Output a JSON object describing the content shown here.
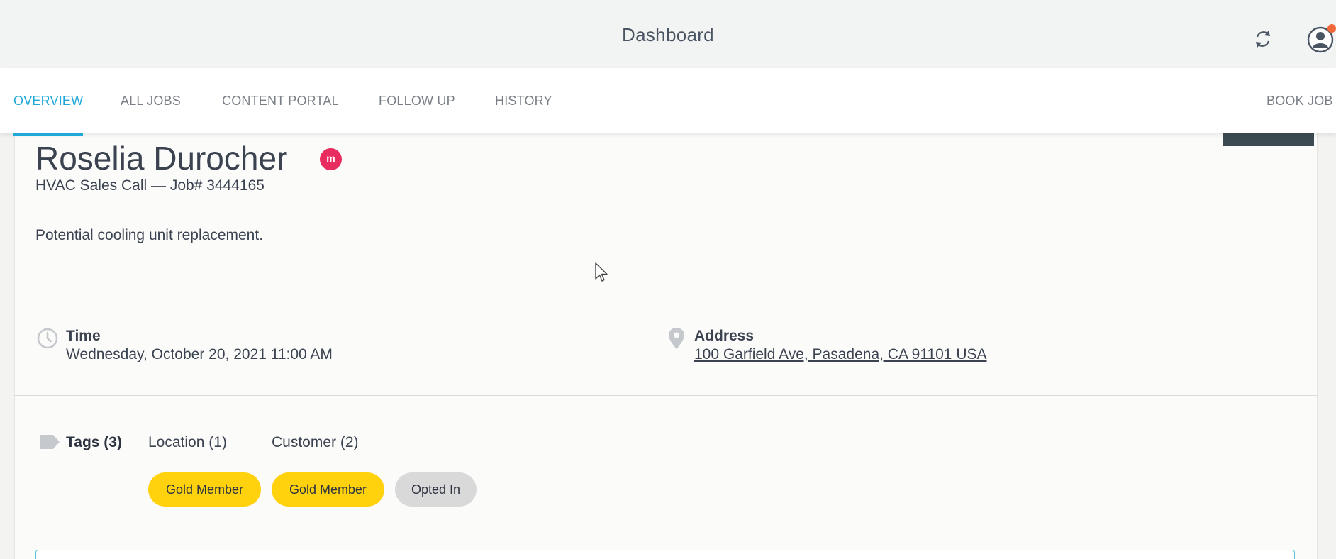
{
  "header": {
    "title": "Dashboard",
    "sync_icon": "sync-icon",
    "avatar_icon": "user-avatar-icon",
    "notification_color": "#f2683a"
  },
  "nav": {
    "tabs": [
      {
        "label": "OVERVIEW",
        "active": true
      },
      {
        "label": "ALL JOBS",
        "active": false
      },
      {
        "label": "CONTENT PORTAL",
        "active": false
      },
      {
        "label": "FOLLOW UP",
        "active": false
      },
      {
        "label": "HISTORY",
        "active": false
      }
    ],
    "book_job": "BOOK JOB",
    "accent_color": "#1fa8d8"
  },
  "job": {
    "customer_name": "Roselia Durocher",
    "member_badge": "m",
    "job_line": "HVAC Sales Call — Job# 3444165",
    "description": "Potential cooling unit replacement.",
    "time_label": "Time",
    "time_value": "Wednesday, October 20, 2021 11:00 AM",
    "address_label": "Address",
    "address_value": "100 Garfield Ave, Pasadena, CA 91101 USA"
  },
  "tags": {
    "tabs": {
      "tags": "Tags (3)",
      "location": "Location (1)",
      "customer": "Customer (2)"
    },
    "chips": [
      {
        "label": "Gold Member",
        "color": "#ffd20d"
      },
      {
        "label": "Gold Member",
        "color": "#ffd20d"
      },
      {
        "label": "Opted In",
        "color": "#d9d9d9"
      }
    ]
  }
}
